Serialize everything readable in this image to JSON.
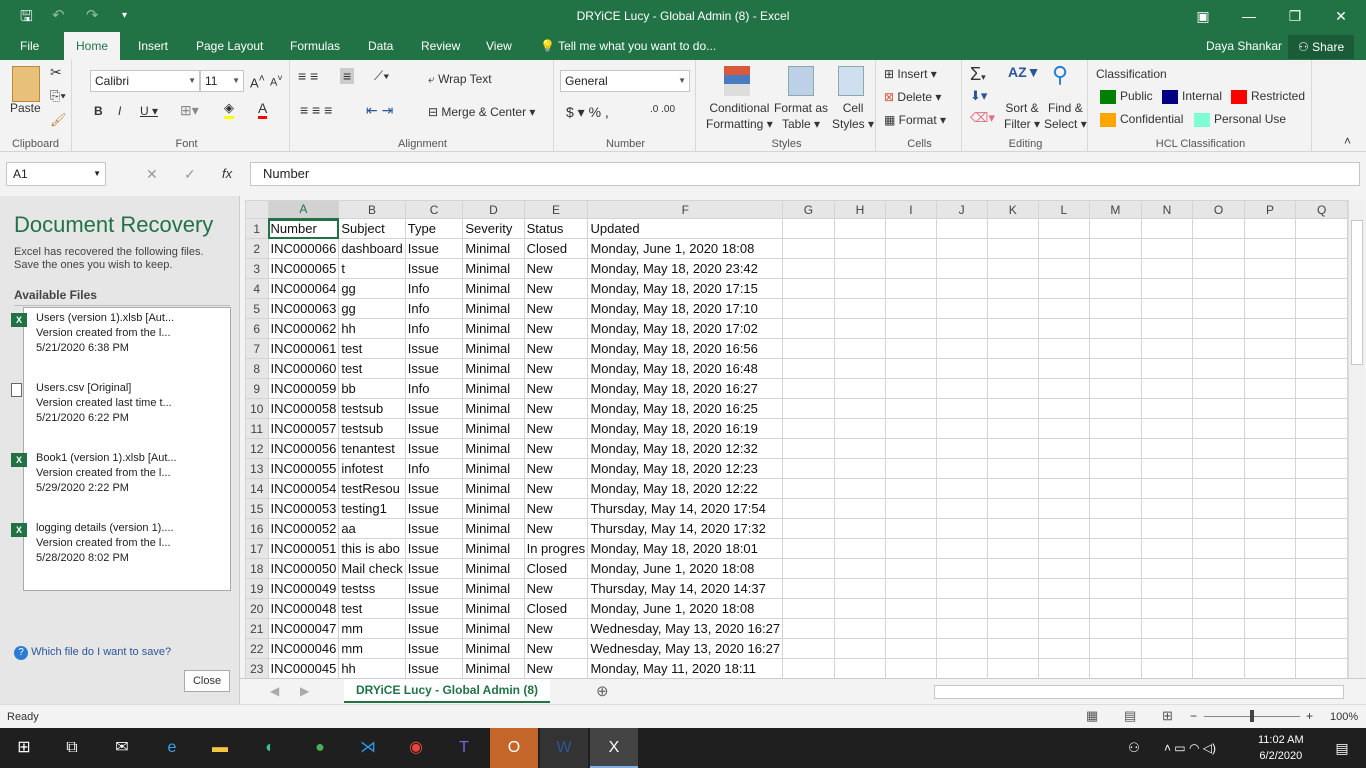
{
  "title": "DRYiCE Lucy - Global Admin (8) - Excel",
  "user": "Daya Shankar",
  "share": "Share",
  "tabs": [
    "File",
    "Home",
    "Insert",
    "Page Layout",
    "Formulas",
    "Data",
    "Review",
    "View"
  ],
  "tell_me": "Tell me what you want to do...",
  "ribbon": {
    "paste": "Paste",
    "clipboard": "Clipboard",
    "font_name": "Calibri",
    "font_size": "11",
    "font": "Font",
    "wrap_text": "Wrap Text",
    "merge_center": "Merge & Center",
    "alignment": "Alignment",
    "number_format": "General",
    "number": "Number",
    "conditional": "Conditional",
    "formatting": "Formatting",
    "format_as": "Format as",
    "table": "Table",
    "cell": "Cell",
    "styles_btn": "Styles",
    "styles": "Styles",
    "insert": "Insert",
    "delete": "Delete",
    "format": "Format",
    "cells": "Cells",
    "sort": "Sort &",
    "filter": "Filter",
    "find": "Find &",
    "select": "Select",
    "editing": "Editing",
    "classification": "Classification",
    "hcl": "HCL Classification",
    "class_items": [
      {
        "label": "Public",
        "color": "#008000"
      },
      {
        "label": "Internal",
        "color": "#000080"
      },
      {
        "label": "Restricted",
        "color": "#ff0000"
      },
      {
        "label": "Confidential",
        "color": "#ffa500"
      },
      {
        "label": "Personal Use",
        "color": "#7fffd4"
      }
    ]
  },
  "name_box": "A1",
  "formula": "Number",
  "recovery": {
    "title": "Document Recovery",
    "desc1": "Excel has recovered the following files.",
    "desc2": "Save the ones you wish to keep.",
    "available": "Available Files",
    "files": [
      {
        "name": "Users (version 1).xlsb  [Aut...",
        "desc": "Version created from the l...",
        "date": "5/21/2020 6:38 PM",
        "icon": "excel"
      },
      {
        "name": "Users.csv  [Original]",
        "desc": "Version created last time t...",
        "date": "5/21/2020 6:22 PM",
        "icon": "file"
      },
      {
        "name": "Book1 (version 1).xlsb  [Aut...",
        "desc": "Version created from the l...",
        "date": "5/29/2020 2:22 PM",
        "icon": "excel"
      },
      {
        "name": "logging details (version 1)....",
        "desc": "Version created from the l...",
        "date": "5/28/2020 8:02 PM",
        "icon": "excel"
      }
    ],
    "help": "Which file do I want to save?",
    "close": "Close"
  },
  "columns": [
    "A",
    "B",
    "C",
    "D",
    "E",
    "F",
    "G",
    "H",
    "I",
    "J",
    "K",
    "L",
    "M",
    "N",
    "O",
    "P",
    "Q"
  ],
  "rows": [
    [
      "Number",
      "Subject",
      "Type",
      "Severity",
      "Status",
      "Updated"
    ],
    [
      "INC000066",
      "dashboard",
      "Issue",
      "Minimal",
      "Closed",
      "Monday, June 1, 2020 18:08"
    ],
    [
      "INC000065",
      "t",
      "Issue",
      "Minimal",
      "New",
      "Monday, May 18, 2020 23:42"
    ],
    [
      "INC000064",
      "gg",
      "Info",
      "Minimal",
      "New",
      "Monday, May 18, 2020 17:15"
    ],
    [
      "INC000063",
      "gg",
      "Info",
      "Minimal",
      "New",
      "Monday, May 18, 2020 17:10"
    ],
    [
      "INC000062",
      "hh",
      "Info",
      "Minimal",
      "New",
      "Monday, May 18, 2020 17:02"
    ],
    [
      "INC000061",
      "test",
      "Issue",
      "Minimal",
      "New",
      "Monday, May 18, 2020 16:56"
    ],
    [
      "INC000060",
      "test",
      "Issue",
      "Minimal",
      "New",
      "Monday, May 18, 2020 16:48"
    ],
    [
      "INC000059",
      "bb",
      "Info",
      "Minimal",
      "New",
      "Monday, May 18, 2020 16:27"
    ],
    [
      "INC000058",
      "testsub",
      "Issue",
      "Minimal",
      "New",
      "Monday, May 18, 2020 16:25"
    ],
    [
      "INC000057",
      "testsub",
      "Issue",
      "Minimal",
      "New",
      "Monday, May 18, 2020 16:19"
    ],
    [
      "INC000056",
      "tenantest",
      "Issue",
      "Minimal",
      "New",
      "Monday, May 18, 2020 12:32"
    ],
    [
      "INC000055",
      "infotest",
      "Info",
      "Minimal",
      "New",
      "Monday, May 18, 2020 12:23"
    ],
    [
      "INC000054",
      "testResou",
      "Issue",
      "Minimal",
      "New",
      "Monday, May 18, 2020 12:22"
    ],
    [
      "INC000053",
      "testing1",
      "Issue",
      "Minimal",
      "New",
      "Thursday, May 14, 2020 17:54"
    ],
    [
      "INC000052",
      "aa",
      "Issue",
      "Minimal",
      "New",
      "Thursday, May 14, 2020 17:32"
    ],
    [
      "INC000051",
      "this is abo",
      "Issue",
      "Minimal",
      "In progres",
      "Monday, May 18, 2020 18:01"
    ],
    [
      "INC000050",
      "Mail check",
      "Issue",
      "Minimal",
      "Closed",
      "Monday, June 1, 2020 18:08"
    ],
    [
      "INC000049",
      "testss",
      "Issue",
      "Minimal",
      "New",
      "Thursday, May 14, 2020 14:37"
    ],
    [
      "INC000048",
      "test",
      "Issue",
      "Minimal",
      "Closed",
      "Monday, June 1, 2020 18:08"
    ],
    [
      "INC000047",
      "mm",
      "Issue",
      "Minimal",
      "New",
      "Wednesday, May 13, 2020 16:27"
    ],
    [
      "INC000046",
      "mm",
      "Issue",
      "Minimal",
      "New",
      "Wednesday, May 13, 2020 16:27"
    ],
    [
      "INC000045",
      "hh",
      "Issue",
      "Minimal",
      "New",
      "Monday, May 11, 2020 18:11"
    ]
  ],
  "sheet_tab": "DRYiCE Lucy - Global Admin (8)",
  "status": "Ready",
  "zoom": "100%",
  "clock": {
    "time": "11:02 AM",
    "date": "6/2/2020"
  }
}
